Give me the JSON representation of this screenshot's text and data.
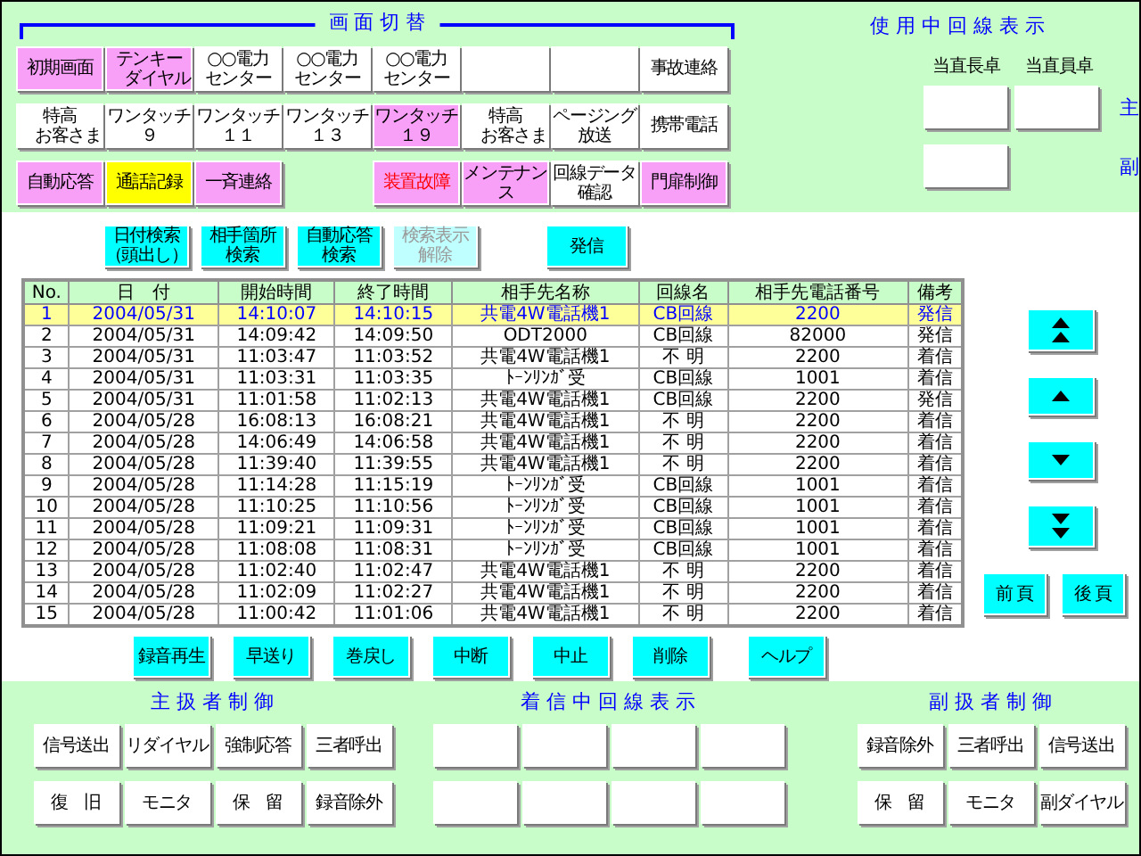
{
  "screen_switch": {
    "title": "画 面 切 替",
    "rows": [
      [
        {
          "lines": [
            "初期画面"
          ],
          "kind": "pink"
        },
        {
          "lines": [
            "テンキー",
            "　ダイヤル"
          ],
          "kind": "pink"
        },
        {
          "lines": [
            "○○電力",
            "センター"
          ],
          "kind": "white"
        },
        {
          "lines": [
            "○○電力",
            "センター"
          ],
          "kind": "white"
        },
        {
          "lines": [
            "○○電力",
            "センター"
          ],
          "kind": "white"
        },
        {
          "kind": "blank"
        },
        {
          "kind": "blank"
        },
        {
          "lines": [
            "事故連絡"
          ],
          "kind": "white"
        }
      ],
      [
        {
          "lines": [
            "特高",
            "　お客さま"
          ],
          "kind": "white"
        },
        {
          "lines": [
            "ワンタッチ",
            "９"
          ],
          "kind": "white"
        },
        {
          "lines": [
            "ワンタッチ",
            "１１"
          ],
          "kind": "white"
        },
        {
          "lines": [
            "ワンタッチ",
            "１３"
          ],
          "kind": "white"
        },
        {
          "lines": [
            "ワンタッチ",
            "１９"
          ],
          "kind": "pink"
        },
        {
          "lines": [
            "特高",
            "　お客さま"
          ],
          "kind": "white"
        },
        {
          "lines": [
            "ページング",
            "放送"
          ],
          "kind": "white"
        },
        {
          "lines": [
            "携帯電話"
          ],
          "kind": "white"
        }
      ],
      [
        {
          "lines": [
            "自動応答"
          ],
          "kind": "pink"
        },
        {
          "lines": [
            "通話記録"
          ],
          "kind": "yellow"
        },
        {
          "lines": [
            "一斉連絡"
          ],
          "kind": "pink"
        },
        {
          "kind": "gap"
        },
        {
          "lines": [
            "装置故障"
          ],
          "kind": "alert"
        },
        {
          "lines": [
            "メンテナン",
            "ス"
          ],
          "kind": "pink"
        },
        {
          "lines": [
            "回線データ",
            "確認"
          ],
          "kind": "white"
        },
        {
          "lines": [
            "門扉制御"
          ],
          "kind": "pink"
        }
      ]
    ]
  },
  "line_usage": {
    "title": "使 用 中 回 線 表 示",
    "columns": [
      "当直長卓",
      "当直員卓"
    ],
    "rows": [
      "主",
      "副"
    ]
  },
  "search_buttons": [
    {
      "lines": [
        "日付検索",
        "（頭出し）"
      ],
      "disabled": false
    },
    {
      "lines": [
        "相手箇所",
        "検索"
      ],
      "disabled": false
    },
    {
      "lines": [
        "自動応答",
        "検索"
      ],
      "disabled": false
    },
    {
      "lines": [
        "検索表示",
        "解除"
      ],
      "disabled": true
    }
  ],
  "call_button": "発信",
  "table": {
    "columns": [
      "No.",
      "日　付",
      "開始時間",
      "終了時間",
      "相手先名称",
      "回線名",
      "相手先電話番号",
      "備考"
    ],
    "rows": [
      {
        "selected": true,
        "cells": [
          "1",
          "2004/05/31",
          "14:10:07",
          "14:10:15",
          "共電4W電話機1",
          "CB回線",
          "2200",
          "発信"
        ]
      },
      {
        "selected": false,
        "cells": [
          "2",
          "2004/05/31",
          "14:09:42",
          "14:09:50",
          "ODT2000",
          "CB回線",
          "82000",
          "発信"
        ]
      },
      {
        "selected": false,
        "cells": [
          "3",
          "2004/05/31",
          "11:03:47",
          "11:03:52",
          "共電4W電話機1",
          "不 明",
          "2200",
          "着信"
        ]
      },
      {
        "selected": false,
        "cells": [
          "4",
          "2004/05/31",
          "11:03:31",
          "11:03:35",
          "ﾄｰﾝﾘﾝｶﾞ受",
          "CB回線",
          "1001",
          "着信"
        ]
      },
      {
        "selected": false,
        "cells": [
          "5",
          "2004/05/31",
          "11:01:58",
          "11:02:13",
          "共電4W電話機1",
          "CB回線",
          "2200",
          "発信"
        ]
      },
      {
        "selected": false,
        "cells": [
          "6",
          "2004/05/28",
          "16:08:13",
          "16:08:21",
          "共電4W電話機1",
          "不 明",
          "2200",
          "着信"
        ]
      },
      {
        "selected": false,
        "cells": [
          "7",
          "2004/05/28",
          "14:06:49",
          "14:06:58",
          "共電4W電話機1",
          "不 明",
          "2200",
          "着信"
        ]
      },
      {
        "selected": false,
        "cells": [
          "8",
          "2004/05/28",
          "11:39:40",
          "11:39:55",
          "共電4W電話機1",
          "不 明",
          "2200",
          "着信"
        ]
      },
      {
        "selected": false,
        "cells": [
          "9",
          "2004/05/28",
          "11:14:28",
          "11:15:19",
          "ﾄｰﾝﾘﾝｶﾞ受",
          "CB回線",
          "1001",
          "着信"
        ]
      },
      {
        "selected": false,
        "cells": [
          "10",
          "2004/05/28",
          "11:10:25",
          "11:10:56",
          "ﾄｰﾝﾘﾝｶﾞ受",
          "CB回線",
          "1001",
          "着信"
        ]
      },
      {
        "selected": false,
        "cells": [
          "11",
          "2004/05/28",
          "11:09:21",
          "11:09:31",
          "ﾄｰﾝﾘﾝｶﾞ受",
          "CB回線",
          "1001",
          "着信"
        ]
      },
      {
        "selected": false,
        "cells": [
          "12",
          "2004/05/28",
          "11:08:08",
          "11:08:31",
          "ﾄｰﾝﾘﾝｶﾞ受",
          "CB回線",
          "1001",
          "着信"
        ]
      },
      {
        "selected": false,
        "cells": [
          "13",
          "2004/05/28",
          "11:02:40",
          "11:02:47",
          "共電4W電話機1",
          "不 明",
          "2200",
          "着信"
        ]
      },
      {
        "selected": false,
        "cells": [
          "14",
          "2004/05/28",
          "11:02:09",
          "11:02:27",
          "共電4W電話機1",
          "不 明",
          "2200",
          "着信"
        ]
      },
      {
        "selected": false,
        "cells": [
          "15",
          "2004/05/28",
          "11:00:42",
          "11:01:06",
          "共電4W電話機1",
          "不 明",
          "2200",
          "着信"
        ]
      }
    ]
  },
  "scroll_buttons": [
    {
      "kind": "top"
    },
    {
      "kind": "up"
    },
    {
      "kind": "down"
    },
    {
      "kind": "bottom"
    }
  ],
  "page_buttons": [
    "前 頁",
    "後 頁"
  ],
  "action_buttons": [
    "録音再生",
    "早送り",
    "巻戻し",
    "中断",
    "中止",
    "削除",
    "ヘルプ"
  ],
  "main_operator": {
    "title": "主 扱 者 制 御",
    "buttons": [
      [
        "信号送出",
        "リダイヤル",
        "強制応答",
        "三者呼出"
      ],
      [
        "復　旧",
        "モニタ",
        "保　留",
        "録音除外"
      ]
    ]
  },
  "incoming": {
    "title": "着 信 中 回 線 表 示"
  },
  "sub_operator": {
    "title": "副 扱 者 制 御",
    "buttons": [
      [
        "録音除外",
        "三者呼出",
        "信号送出"
      ],
      [
        "保　留",
        "モニタ",
        "副ダイヤル"
      ]
    ]
  }
}
